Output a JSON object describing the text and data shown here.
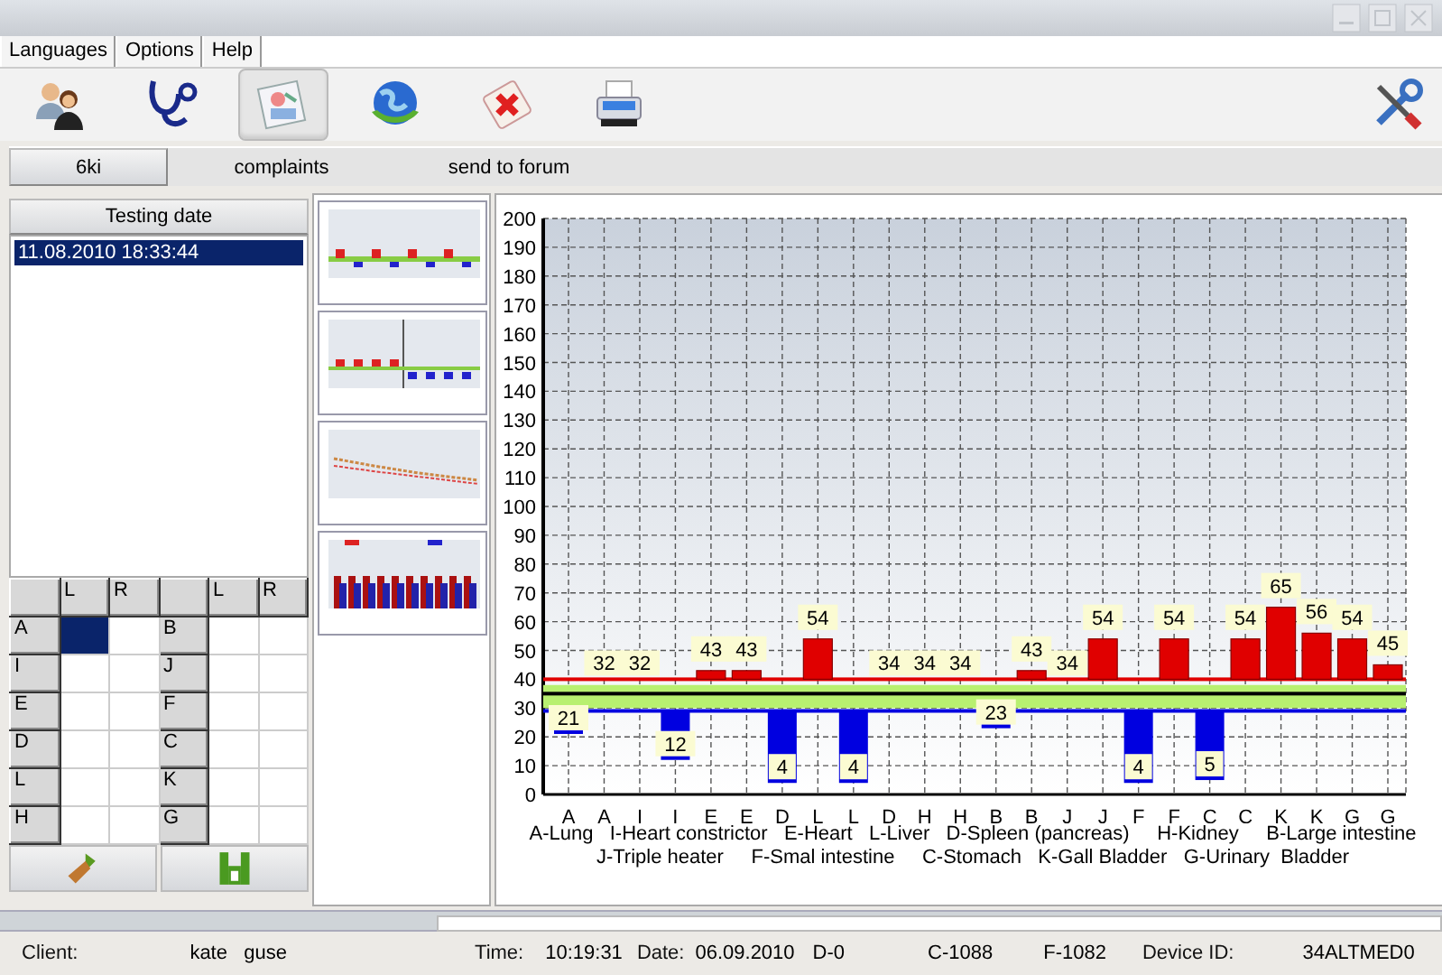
{
  "menu": [
    {
      "label": "Languages"
    },
    {
      "label": "Options"
    },
    {
      "label": "Help"
    }
  ],
  "toolbar": [
    {
      "kind": "people",
      "selected": false
    },
    {
      "kind": "stethoscope",
      "selected": false
    },
    {
      "kind": "report",
      "selected": true
    },
    {
      "kind": "globe",
      "selected": false
    },
    {
      "kind": "medkit",
      "selected": false
    },
    {
      "kind": "printer",
      "selected": false
    },
    {
      "kind": "tools",
      "selected": false
    }
  ],
  "tabs": [
    {
      "label": "6ki",
      "selected": true
    },
    {
      "label": "complaints",
      "selected": false
    },
    {
      "label": "send to forum",
      "selected": false
    }
  ],
  "testing_dates": {
    "header": "Testing date",
    "items": [
      {
        "text": "11.08.2010 18:33:44",
        "selected": true
      }
    ]
  },
  "meridian_grid": {
    "columns": [
      "L",
      "R",
      "L",
      "R"
    ],
    "rows": [
      {
        "left_label": "A",
        "left_cells": [
          {
            "selected": true
          },
          {
            "selected": false
          }
        ],
        "right_label": "B",
        "right_cells": [
          {
            "selected": false
          },
          {
            "selected": false
          }
        ]
      },
      {
        "left_label": "I",
        "left_cells": [
          {
            "selected": false
          },
          {
            "selected": false
          }
        ],
        "right_label": "J",
        "right_cells": [
          {
            "selected": false
          },
          {
            "selected": false
          }
        ]
      },
      {
        "left_label": "E",
        "left_cells": [
          {
            "selected": false
          },
          {
            "selected": false
          }
        ],
        "right_label": "F",
        "right_cells": [
          {
            "selected": false
          },
          {
            "selected": false
          }
        ]
      },
      {
        "left_label": "D",
        "left_cells": [
          {
            "selected": false
          },
          {
            "selected": false
          }
        ],
        "right_label": "C",
        "right_cells": [
          {
            "selected": false
          },
          {
            "selected": false
          }
        ]
      },
      {
        "left_label": "L",
        "left_cells": [
          {
            "selected": false
          },
          {
            "selected": false
          }
        ],
        "right_label": "K",
        "right_cells": [
          {
            "selected": false
          },
          {
            "selected": false
          }
        ]
      },
      {
        "left_label": "H",
        "left_cells": [
          {
            "selected": false
          },
          {
            "selected": false
          }
        ],
        "right_label": "G",
        "right_cells": [
          {
            "selected": false
          },
          {
            "selected": false
          }
        ]
      }
    ]
  },
  "actions": [
    {
      "kind": "clear"
    },
    {
      "kind": "save"
    }
  ],
  "thumbnails": [
    {
      "kind": "bars"
    },
    {
      "kind": "split"
    },
    {
      "kind": "line"
    },
    {
      "kind": "columns"
    }
  ],
  "chart": {
    "y_ticks": [
      "200",
      "190",
      "180",
      "170",
      "160",
      "150",
      "140",
      "130",
      "120",
      "110",
      "100",
      "90",
      "80",
      "70",
      "60",
      "50",
      "40",
      "30",
      "20",
      "10",
      "0"
    ],
    "bars": [
      {
        "category": "A",
        "label": "21",
        "kind": "below"
      },
      {
        "category": "A",
        "label": "32",
        "kind": "norm"
      },
      {
        "category": "I",
        "label": "32",
        "kind": "norm"
      },
      {
        "category": "I",
        "label": "12",
        "kind": "below"
      },
      {
        "category": "E",
        "label": "43",
        "kind": "above"
      },
      {
        "category": "E",
        "label": "43",
        "kind": "above"
      },
      {
        "category": "D",
        "label": "4",
        "kind": "below"
      },
      {
        "category": "L",
        "label": "54",
        "kind": "above"
      },
      {
        "category": "L",
        "label": "4",
        "kind": "below"
      },
      {
        "category": "D",
        "label": "34",
        "kind": "norm"
      },
      {
        "category": "H",
        "label": "34",
        "kind": "norm"
      },
      {
        "category": "H",
        "label": "34",
        "kind": "norm"
      },
      {
        "category": "B",
        "label": "23",
        "kind": "below"
      },
      {
        "category": "B",
        "label": "43",
        "kind": "above"
      },
      {
        "category": "J",
        "label": "34",
        "kind": "norm"
      },
      {
        "category": "J",
        "label": "54",
        "kind": "above"
      },
      {
        "category": "F",
        "label": "4",
        "kind": "below"
      },
      {
        "category": "F",
        "label": "54",
        "kind": "above"
      },
      {
        "category": "C",
        "label": "5",
        "kind": "below"
      },
      {
        "category": "C",
        "label": "54",
        "kind": "above"
      },
      {
        "category": "K",
        "label": "65",
        "kind": "above"
      },
      {
        "category": "K",
        "label": "56",
        "kind": "above"
      },
      {
        "category": "G",
        "label": "54",
        "kind": "above"
      },
      {
        "category": "G",
        "label": "45",
        "kind": "above"
      }
    ],
    "legend": [
      "A-Lung   I-Heart constrictor   E-Heart   L-Liver   D-Spleen (pancreas)     H-Kidney     B-Large intestine",
      "J-Triple heater     F-Smal intestine     C-Stomach   K-Gall Bladder   G-Urinary  Bladder"
    ]
  },
  "status_bar": [
    {
      "kind": "label",
      "text": "Client:"
    },
    {
      "kind": "value",
      "text": "kate   guse"
    },
    {
      "kind": "label",
      "text": "Time:"
    },
    {
      "kind": "value",
      "text": "10:19:31"
    },
    {
      "kind": "label",
      "text": "Date:"
    },
    {
      "kind": "value",
      "text": "06.09.2010"
    },
    {
      "kind": "value",
      "text": "D-0"
    },
    {
      "kind": "value",
      "text": "C-1088"
    },
    {
      "kind": "value",
      "text": "F-1082"
    },
    {
      "kind": "label",
      "text": "Device ID:"
    },
    {
      "kind": "value",
      "text": "34ALTMED0"
    }
  ]
}
